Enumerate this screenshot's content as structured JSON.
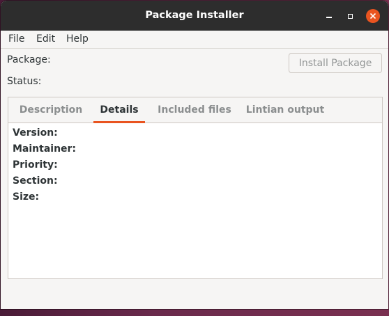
{
  "window": {
    "title": "Package Installer"
  },
  "menubar": {
    "items": [
      "File",
      "Edit",
      "Help"
    ]
  },
  "info": {
    "package_label": "Package:",
    "status_label": "Status:",
    "install_button_label": "Install Package",
    "install_button_enabled": false
  },
  "tabs": {
    "items": [
      "Description",
      "Details",
      "Included files",
      "Lintian output"
    ],
    "active": "Details"
  },
  "details": {
    "fields": [
      "Version:",
      "Maintainer:",
      "Priority:",
      "Section:",
      "Size:"
    ]
  },
  "colors": {
    "titlebar": "#2d2d2d",
    "accent": "#e95420",
    "window_bg": "#f6f5f4",
    "disabled_text": "#929595"
  }
}
